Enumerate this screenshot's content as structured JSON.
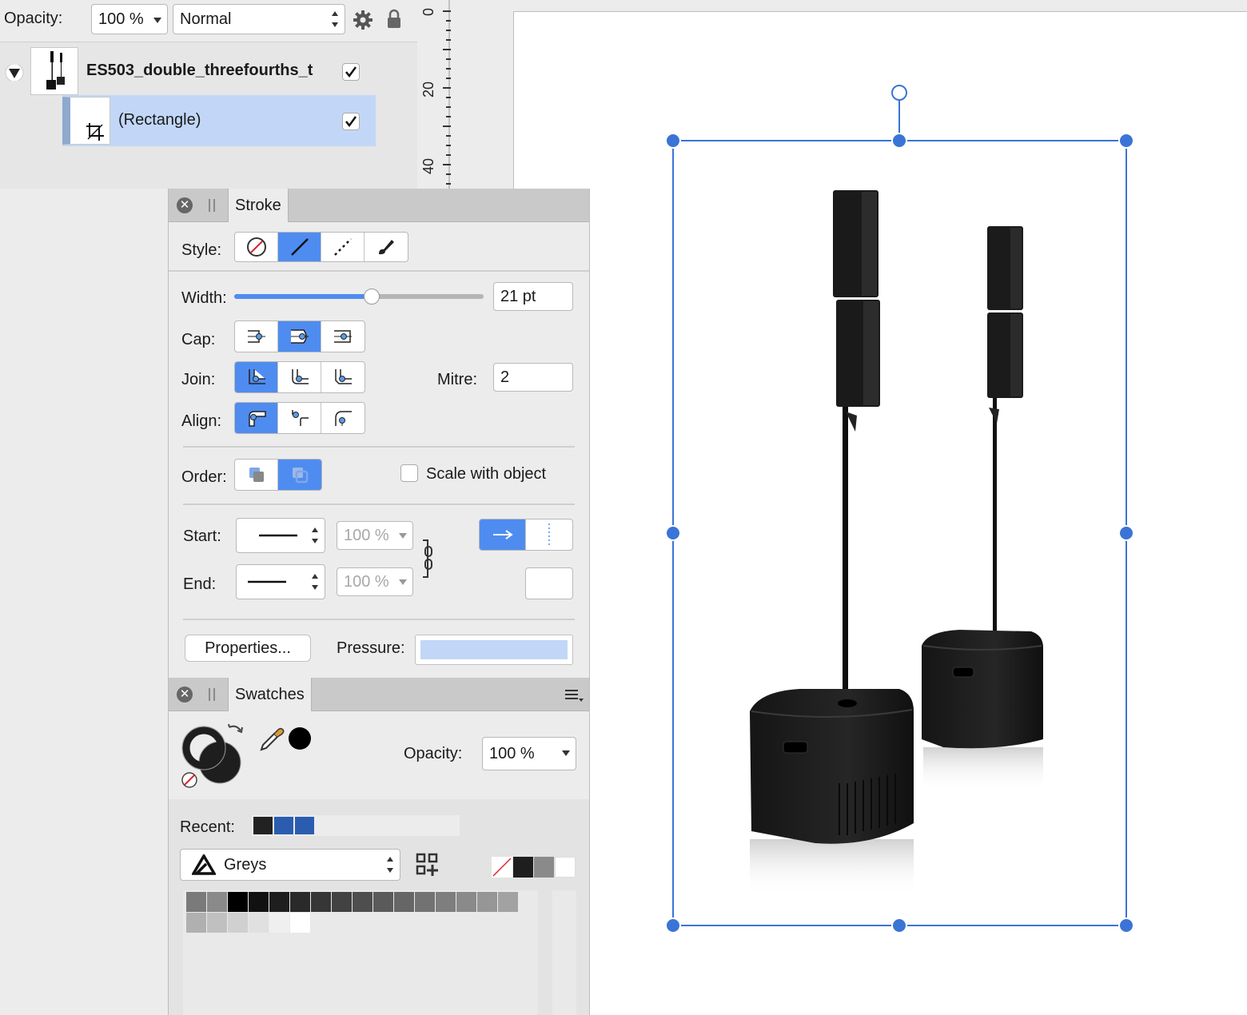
{
  "toolbar": {
    "opacity_label": "Opacity:",
    "opacity_value": "100 %",
    "blend_mode": "Normal"
  },
  "ruler": {
    "ticks": [
      "0",
      "20",
      "40"
    ]
  },
  "layers": {
    "items": [
      {
        "name": "ES503_double_threefourths_t",
        "visible": true
      },
      {
        "name": "(Rectangle)",
        "visible": true
      }
    ]
  },
  "stroke": {
    "tab": "Stroke",
    "style_label": "Style:",
    "width_label": "Width:",
    "width_value": "21 pt",
    "width_fraction": 0.55,
    "cap_label": "Cap:",
    "join_label": "Join:",
    "mitre_label": "Mitre:",
    "mitre_value": "2",
    "align_label": "Align:",
    "order_label": "Order:",
    "scale_label": "Scale with object",
    "start_label": "Start:",
    "start_pct": "100 %",
    "end_label": "End:",
    "end_pct": "100 %",
    "properties_label": "Properties...",
    "pressure_label": "Pressure:"
  },
  "swatches": {
    "tab": "Swatches",
    "opacity_label": "Opacity:",
    "opacity_value": "100 %",
    "recent_label": "Recent:",
    "palette_name": "Greys",
    "recent_colors": [
      "#222222",
      "#2a5db0",
      "#2a5db0"
    ],
    "quick_colors": [
      "#1e1e1e",
      "#8a8a8a",
      "#ffffff"
    ],
    "grey_row1": [
      "#7a7a7a",
      "#8a8a8a",
      "#000000",
      "#111111",
      "#1e1e1e",
      "#2a2a2a",
      "#363636",
      "#424242",
      "#4e4e4e",
      "#5a5a5a",
      "#666666",
      "#727272",
      "#7e7e7e",
      "#8a8a8a",
      "#969696",
      "#a2a2a2"
    ],
    "grey_row2": [
      "#b0b0b0",
      "#c0c0c0",
      "#d0d0d0",
      "#e0e0e0",
      "#efefef",
      "#ffffff"
    ]
  },
  "colors": {
    "accent": "#4f8cf0",
    "selection": "#3a74d6",
    "layer_selected": "#c2d7f7"
  }
}
